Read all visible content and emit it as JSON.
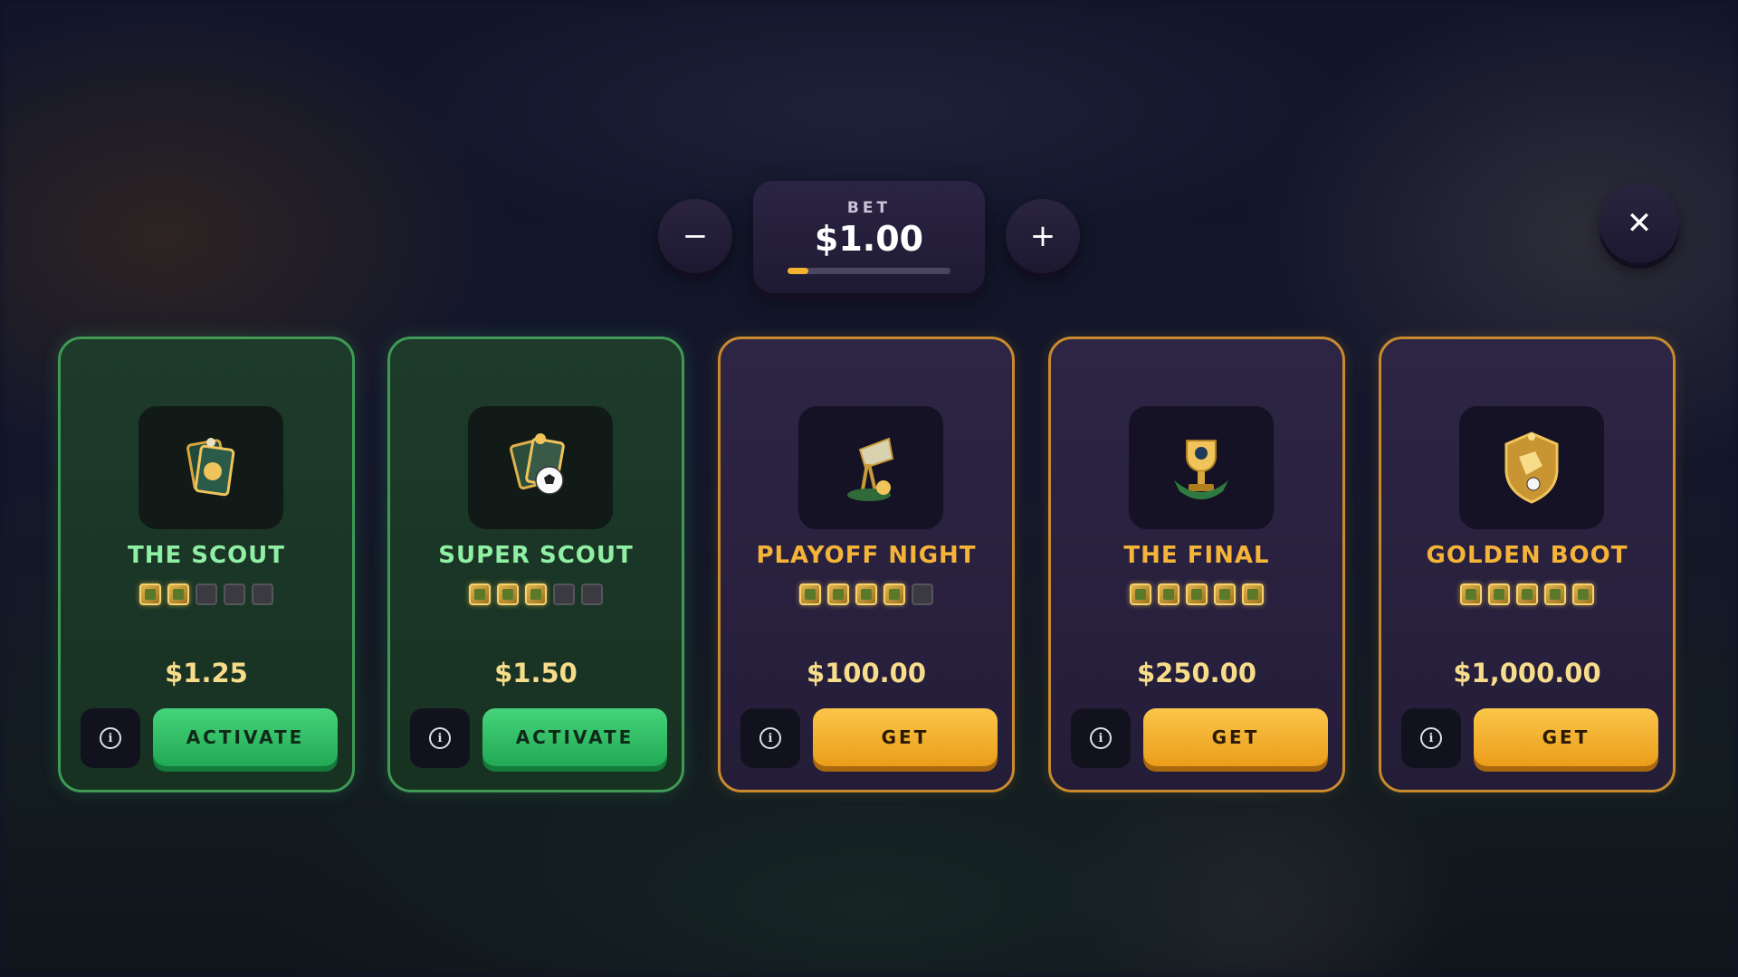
{
  "bet": {
    "label": "BET",
    "value": "$1.00",
    "level_fraction": 0.13
  },
  "controls": {
    "minus": "−",
    "plus": "+",
    "close": "✕"
  },
  "cards": [
    {
      "title": "THE SCOUT",
      "icon": "scout-cards-icon",
      "stars_filled": 2,
      "stars_total": 5,
      "price": "$1.25",
      "action": "ACTIVATE",
      "style": "green"
    },
    {
      "title": "SUPER SCOUT",
      "icon": "super-scout-ball-icon",
      "stars_filled": 3,
      "stars_total": 5,
      "price": "$1.50",
      "action": "ACTIVATE",
      "style": "green"
    },
    {
      "title": "PLAYOFF NIGHT",
      "icon": "floodlight-icon",
      "stars_filled": 4,
      "stars_total": 5,
      "price": "$100.00",
      "action": "GET",
      "style": "gold"
    },
    {
      "title": "THE FINAL",
      "icon": "trophy-icon",
      "stars_filled": 5,
      "stars_total": 5,
      "price": "$250.00",
      "action": "GET",
      "style": "gold"
    },
    {
      "title": "GOLDEN BOOT",
      "icon": "golden-boot-crest-icon",
      "stars_filled": 5,
      "stars_total": 5,
      "price": "$1,000.00",
      "action": "GET",
      "style": "gold"
    }
  ],
  "colors": {
    "green_accent": "#45d47a",
    "gold_accent": "#f5b437",
    "panel": "#241d38"
  }
}
